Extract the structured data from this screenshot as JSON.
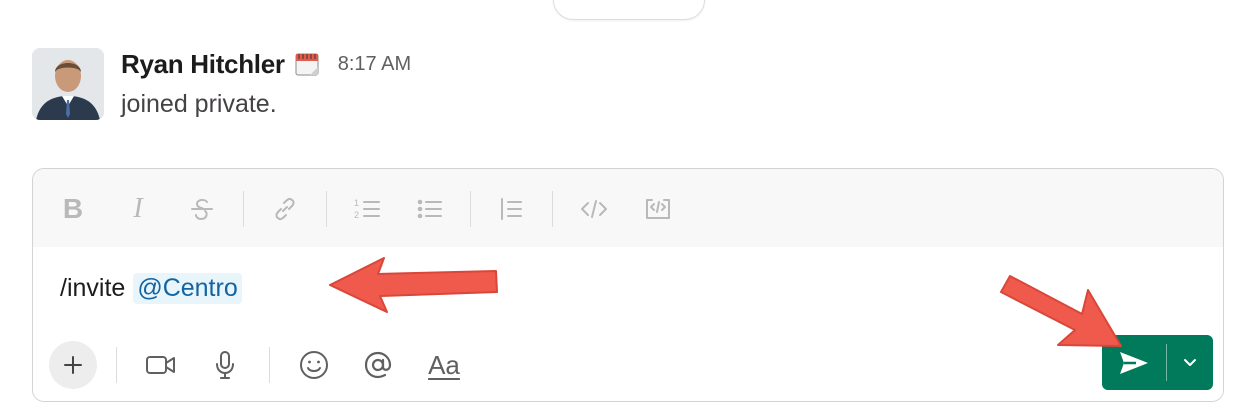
{
  "message": {
    "sender": "Ryan Hitchler",
    "status_icon": "calendar-emoji",
    "timestamp": "8:17 AM",
    "text": "joined private."
  },
  "composer": {
    "formatting_toolbar": [
      "bold",
      "italic",
      "strikethrough",
      "link",
      "ordered-list",
      "bulleted-list",
      "blockquote",
      "code",
      "code-block"
    ],
    "input": {
      "command": "/invite",
      "mention": "@Centro"
    },
    "bottom_toolbar": {
      "aa_label": "Aa"
    }
  },
  "colors": {
    "send_button": "#007a5a",
    "mention_bg": "#e8f5fa",
    "mention_text": "#1264a3",
    "annotation_arrow": "#ef5a4c"
  }
}
